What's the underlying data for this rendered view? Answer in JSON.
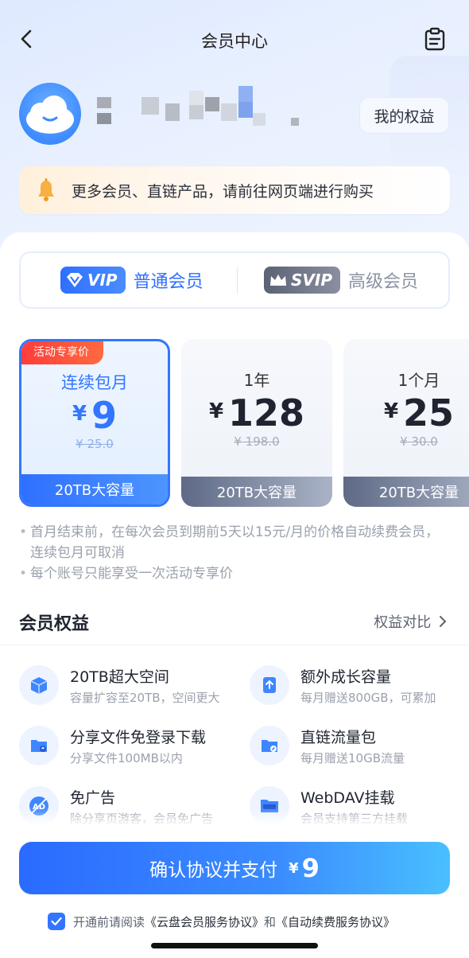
{
  "header": {
    "title": "会员中心",
    "rights_button": "我的权益"
  },
  "notice": {
    "text": "更多会员、直链产品，请前往网页端进行购买"
  },
  "tabs": {
    "vip_badge": "VIP",
    "vip_label": "普通会员",
    "svip_badge": "SVIP",
    "svip_label": "高级会员"
  },
  "plans": [
    {
      "tag": "活动专享价",
      "name": "连续包月",
      "currency": "¥",
      "price": "9",
      "original": "¥ 25.0",
      "capacity": "20TB大容量",
      "selected": true
    },
    {
      "name": "1年",
      "currency": "¥",
      "price": "128",
      "original": "¥ 198.0",
      "capacity": "20TB大容量",
      "selected": false
    },
    {
      "name": "1个月",
      "currency": "¥",
      "price": "25",
      "original": "¥ 30.0",
      "capacity": "20TB大容量",
      "selected": false
    }
  ],
  "notes": [
    "首月结束前，在每次会员到期前5天以15元/月的价格自动续费会员，连续包月可取消",
    "每个账号只能享受一次活动专享价"
  ],
  "benefits_section": {
    "title": "会员权益",
    "compare_link": "权益对比"
  },
  "benefits": [
    {
      "icon": "cube-icon",
      "title": "20TB超大空间",
      "desc": "容量扩容至20TB，空间更大"
    },
    {
      "icon": "growth-icon",
      "title": "额外成长容量",
      "desc": "每月赠送800GB，可累加"
    },
    {
      "icon": "share-folder-icon",
      "title": "分享文件免登录下载",
      "desc": "分享文件100MB以内"
    },
    {
      "icon": "link-folder-icon",
      "title": "直链流量包",
      "desc": "每月赠送10GB流量"
    },
    {
      "icon": "no-ads-icon",
      "title": "免广告",
      "desc": "除分享页游客，会员免广告"
    },
    {
      "icon": "webdav-icon",
      "title": "WebDAV挂载",
      "desc": "会员支持第三方挂载"
    }
  ],
  "pay": {
    "label": "确认协议并支付",
    "currency": "¥",
    "amount": "9"
  },
  "agreement": {
    "prefix": "开通前请阅读",
    "link1": "《云盘会员服务协议》",
    "and": "和",
    "link2": "《自动续费服务协议》"
  },
  "colors": {
    "accent": "#3276ff",
    "promo": "#ff3b3b",
    "muted": "#9aa1ad"
  }
}
